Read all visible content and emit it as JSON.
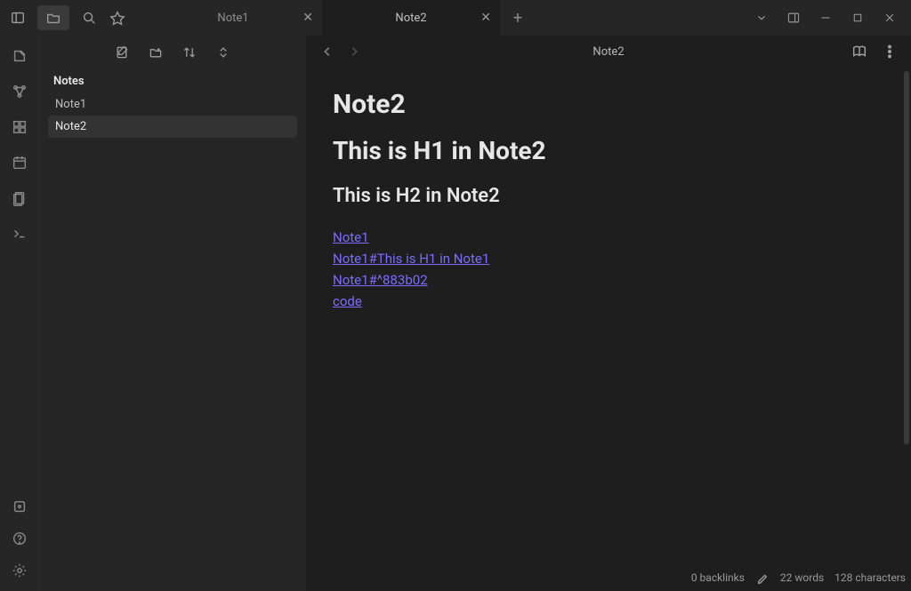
{
  "tabs": [
    {
      "label": "Note1",
      "active": false
    },
    {
      "label": "Note2",
      "active": true
    }
  ],
  "sidebar": {
    "vault_title": "Notes",
    "files": [
      "Note1",
      "Note2"
    ],
    "selected": "Note2"
  },
  "editor": {
    "header_title": "Note2",
    "note_title": "Note2",
    "h1": "This is H1 in Note2",
    "h2": "This is H2 in Note2",
    "links": [
      "Note1",
      "Note1#This is H1 in Note1",
      "Note1#^883b02",
      "code"
    ]
  },
  "status": {
    "backlinks": "0 backlinks",
    "words": "22 words",
    "chars": "128 characters"
  }
}
